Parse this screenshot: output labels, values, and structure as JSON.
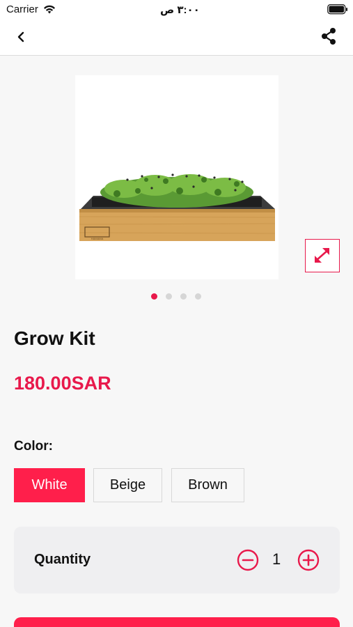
{
  "status_bar": {
    "carrier": "Carrier",
    "time": "٣:٠٠ ص",
    "wifi_icon": "wifi-icon",
    "battery_icon": "battery-icon"
  },
  "nav": {
    "back_icon": "chevron-left-icon",
    "share_icon": "share-icon"
  },
  "product": {
    "title": "Grow Kit",
    "price": "180.00SAR",
    "image_brand_text": "HAMAMA",
    "gallery": {
      "image_count": 4,
      "active_index": 0,
      "expand_icon": "expand-icon"
    }
  },
  "color": {
    "label": "Color:",
    "options": [
      "White",
      "Beige",
      "Brown"
    ],
    "selected": "White"
  },
  "quantity": {
    "label": "Quantity",
    "value": "1",
    "minus_icon": "minus-circle-icon",
    "plus_icon": "plus-circle-icon"
  },
  "colors": {
    "accent": "#e8194b",
    "selected_option_bg": "#ff1f4b",
    "background": "#f7f7f7"
  }
}
